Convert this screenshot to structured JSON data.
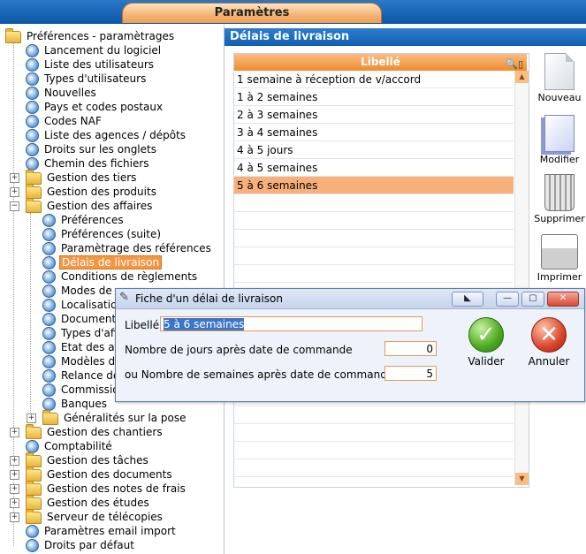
{
  "window": {
    "title": "Paramètres"
  },
  "tree": {
    "root": "Préférences - paramètrages",
    "items": [
      "Lancement du logiciel",
      "Liste des utilisateurs",
      "Types d'utilisateurs",
      "Nouvelles",
      "Pays et codes postaux",
      "Codes NAF",
      "Liste des agences / dépôts",
      "Droits sur les onglets",
      "Chemin des fichiers",
      "Gestion des tiers",
      "Gestion des produits",
      "Gestion des affaires",
      "Préférences",
      "Préférences (suite)",
      "Paramètrage des références",
      "Délais de livraison",
      "Conditions de règlements",
      "Modes de r",
      "Localisation",
      "Documents",
      "Types d'aff",
      "Etat des aff",
      "Modèles d'i",
      "Relance de",
      "Commission",
      "Banques",
      "Généralités sur la pose",
      "Gestion des chantiers",
      "Comptabilité",
      "Gestion des tâches",
      "Gestion des documents",
      "Gestion des notes de frais",
      "Gestion des études",
      "Serveur de télécopies",
      "Paramètres email import",
      "Droits par défaut"
    ]
  },
  "panel": {
    "title": "Délais de livraison",
    "column_header": "Libellé",
    "rows": [
      "1 semaine à réception de v/accord",
      "1 à 2 semaines",
      "2 à 3 semaines",
      "3 à 4 semaines",
      "4 à 5 jours",
      "4 à 5 semaines",
      "5 à 6 semaines"
    ],
    "selected_row": "5 à 6 semaines"
  },
  "toolbar": {
    "new": "Nouveau",
    "edit": "Modifier",
    "delete": "Supprimer",
    "print": "Imprimer"
  },
  "dialog": {
    "title": "Fiche d'un délai de livraison",
    "libelle_label": "Libellé",
    "libelle_value": "5 à 6 semaines",
    "days_label": "Nombre de jours après date de commande",
    "days_value": "0",
    "weeks_label": "ou Nombre de semaines après date de commande",
    "weeks_value": "5",
    "validate": "Valider",
    "cancel": "Annuler"
  },
  "colors": {
    "accent": "#f08a2e",
    "header_blue": "#1260b0",
    "selection": "#f8b07a"
  }
}
